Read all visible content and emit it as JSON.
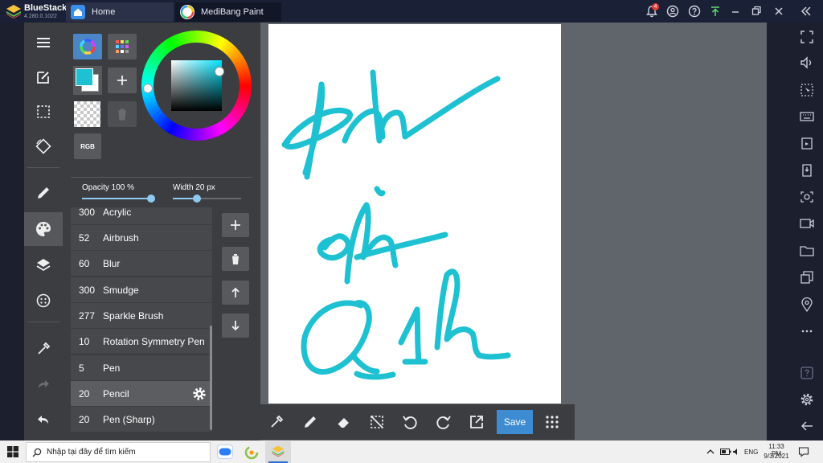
{
  "bluestacks": {
    "name": "BlueStacks",
    "version": "4.280.0.1022",
    "tabs": [
      {
        "label": "Home"
      },
      {
        "label": "MediBang Paint"
      }
    ],
    "notification_count": "4"
  },
  "color_panel": {
    "rgb_label": "RGB",
    "current_color": "#1ec1d1"
  },
  "sliders": {
    "opacity_label": "Opacity 100 %",
    "opacity_value": 1.0,
    "width_label": "Width 20 px",
    "width_value": 0.35
  },
  "brushes": [
    {
      "size": "300",
      "name": "Acrylic"
    },
    {
      "size": "52",
      "name": "Airbrush"
    },
    {
      "size": "60",
      "name": "Blur"
    },
    {
      "size": "300",
      "name": "Smudge"
    },
    {
      "size": "277",
      "name": "Sparkle Brush"
    },
    {
      "size": "10",
      "name": "Rotation Symmetry Pen"
    },
    {
      "size": "5",
      "name": "Pen"
    },
    {
      "size": "20",
      "name": "Pencil",
      "selected": true
    },
    {
      "size": "20",
      "name": "Pen (Sharp)"
    }
  ],
  "bottombar": {
    "save_label": "Save"
  },
  "taskbar": {
    "search_placeholder": "Nhập tại đây để tìm kiếm",
    "language": "ENG",
    "time": "11:33 PM",
    "date": "9/3/2021"
  },
  "colors": {
    "stroke": "#1ec1d1",
    "accent": "#3d8cd1"
  }
}
